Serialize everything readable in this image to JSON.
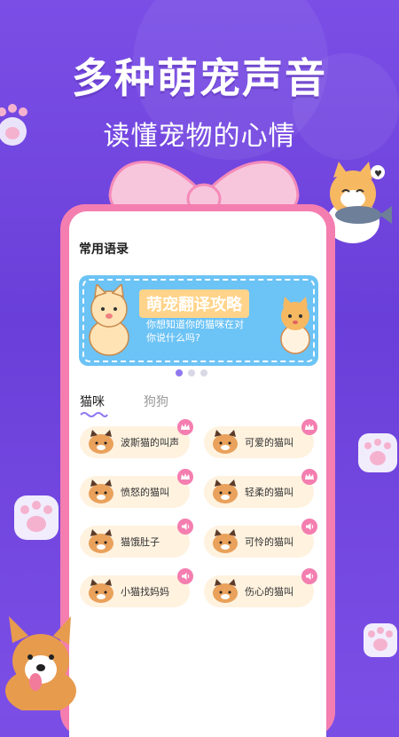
{
  "header": {
    "headline": "多种萌宠声音",
    "subline": "读懂宠物的心情"
  },
  "section": {
    "title": "常用语录"
  },
  "banner": {
    "title": "萌宠翻译攻略",
    "subtitle": "你想知道你的猫咪在对你说什么吗?"
  },
  "tabs": [
    {
      "label": "猫咪",
      "active": true
    },
    {
      "label": "狗狗",
      "active": false
    }
  ],
  "sounds": [
    {
      "label": "波斯猫的叫声",
      "badge": "crown-icon"
    },
    {
      "label": "可爱的猫叫",
      "badge": "crown-icon"
    },
    {
      "label": "愤怒的猫叫",
      "badge": "crown-icon"
    },
    {
      "label": "轻柔的猫叫",
      "badge": "crown-icon"
    },
    {
      "label": "猫饿肚子",
      "badge": "speaker-icon"
    },
    {
      "label": "可怜的猫叫",
      "badge": "speaker-icon"
    },
    {
      "label": "小猫找妈妈",
      "badge": "speaker-icon"
    },
    {
      "label": "伤心的猫叫",
      "badge": "speaker-icon"
    }
  ],
  "colors": {
    "background": "#7b4fe6",
    "phone_frame": "#f47eb0",
    "card": "#fff2df",
    "banner": "#6cc3f5",
    "active_dot": "#8f78ef"
  }
}
